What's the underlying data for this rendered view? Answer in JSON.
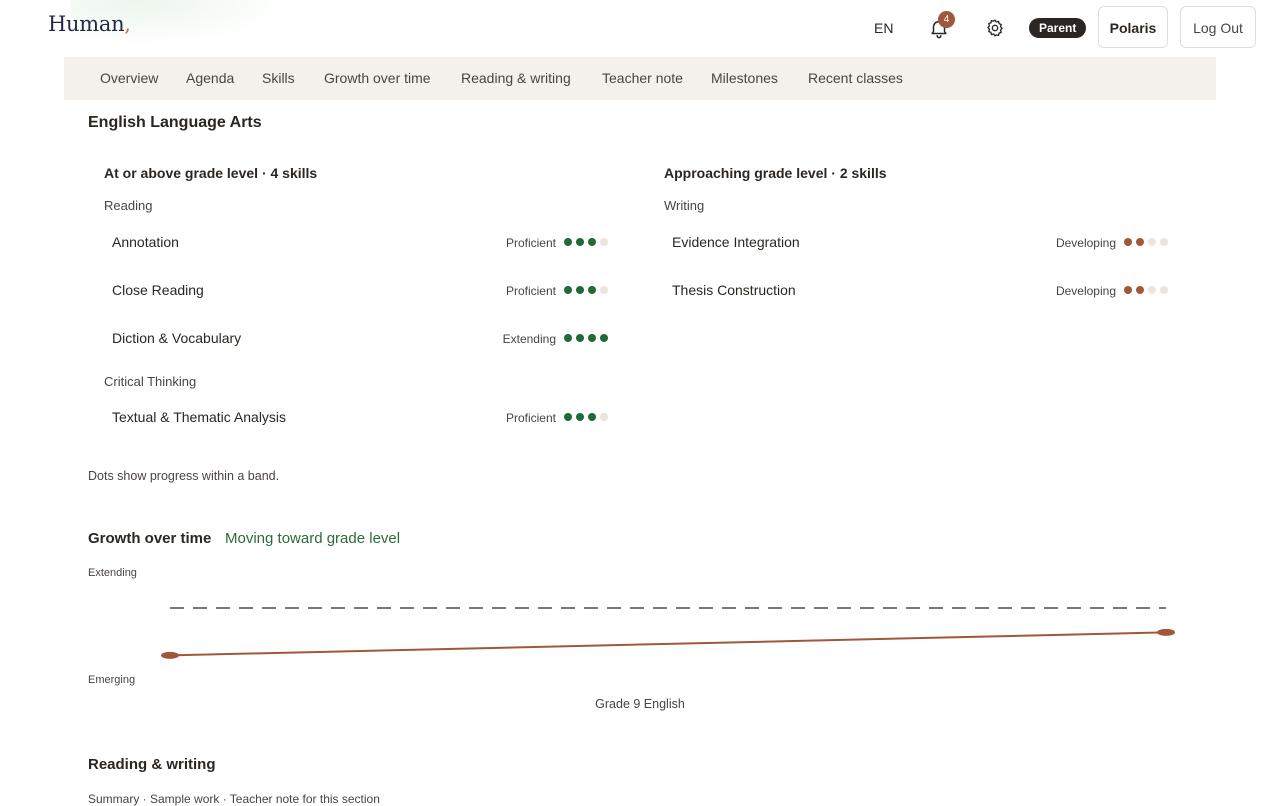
{
  "header": {
    "brand": "Human",
    "brand_mark": ",",
    "language": "EN",
    "notifications_count": "4",
    "role": "Parent",
    "user": "Polaris",
    "logout": "Log Out",
    "icons": {
      "notifications": "bell-icon",
      "settings": "gear-icon"
    }
  },
  "tabs": [
    {
      "label": "Overview"
    },
    {
      "label": "Agenda"
    },
    {
      "label": "Skills"
    },
    {
      "label": "Growth over time"
    },
    {
      "label": "Reading & writing"
    },
    {
      "label": "Teacher note"
    },
    {
      "label": "Milestones"
    },
    {
      "label": "Recent classes"
    }
  ],
  "subject": {
    "title": "English Language Arts",
    "bands": [
      {
        "title": "At or above grade level · 4 skills",
        "dot_color": "#1f6a38",
        "groups": [
          {
            "label": "Reading",
            "skills": [
              {
                "name": "Annotation",
                "level": "Proficient",
                "dots_filled": 3,
                "dots_total": 4
              },
              {
                "name": "Close Reading",
                "level": "Proficient",
                "dots_filled": 3,
                "dots_total": 4
              },
              {
                "name": "Diction & Vocabulary",
                "level": "Extending",
                "dots_filled": 4,
                "dots_total": 4
              }
            ]
          },
          {
            "label": "Critical Thinking",
            "skills": [
              {
                "name": "Textual & Thematic Analysis",
                "level": "Proficient",
                "dots_filled": 3,
                "dots_total": 4
              }
            ]
          }
        ]
      },
      {
        "title": "Approaching grade level · 2 skills",
        "dot_color": "#a0573a",
        "groups": [
          {
            "label": "Writing",
            "skills": [
              {
                "name": "Evidence Integration",
                "level": "Developing",
                "dots_filled": 2,
                "dots_total": 4
              },
              {
                "name": "Thesis Construction",
                "level": "Developing",
                "dots_filled": 2,
                "dots_total": 4
              }
            ]
          }
        ]
      }
    ],
    "note": "Dots show progress within a band."
  },
  "growth": {
    "title": "Growth over time",
    "status": "Moving toward grade level",
    "status_color": "#2e6b3a",
    "line_color": "#a0573a",
    "y_top_label": "Extending",
    "y_bottom_label": "Emerging",
    "caption": "Grade 9 English"
  },
  "chart_data": {
    "type": "line",
    "title": "",
    "xlabel": "Grade 9 English",
    "ylabel": "",
    "y_scale": [
      "Emerging",
      "Extending"
    ],
    "reference_line": "dashed, near top of scale",
    "grid": false,
    "series": [
      {
        "values": [
          0.05,
          0.3
        ]
      }
    ]
  },
  "reading_writing": {
    "title": "Reading & writing",
    "cut_text": "Summary · Sample work · Teacher note for this section"
  }
}
